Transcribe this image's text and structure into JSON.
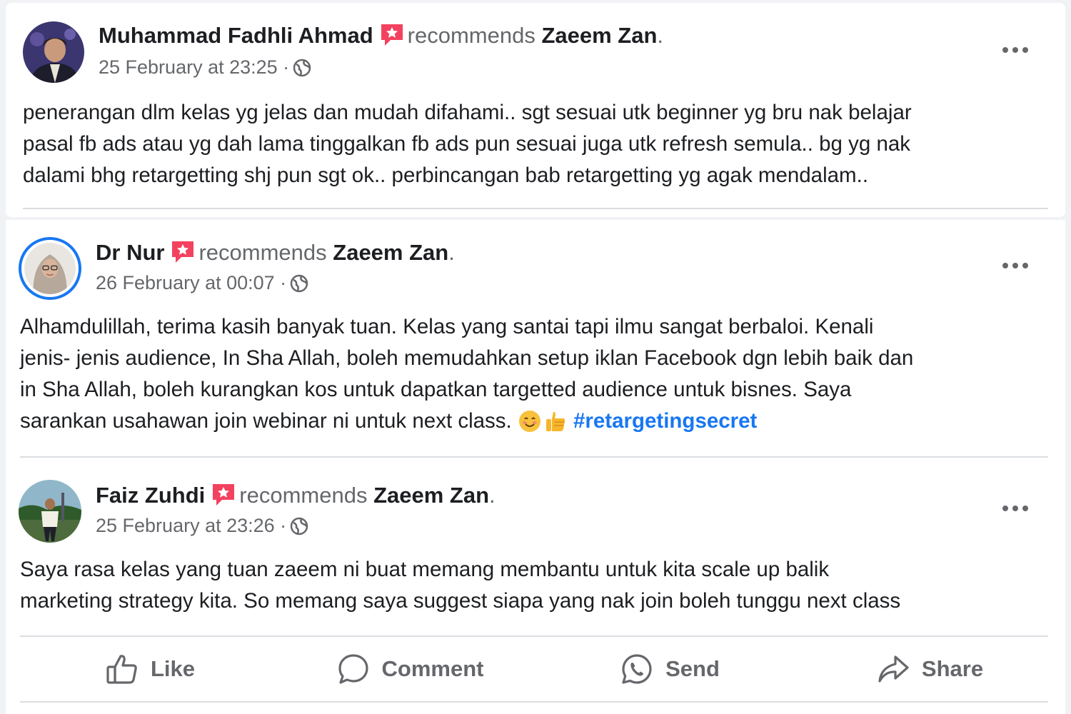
{
  "posts": [
    {
      "author": "Muhammad Fadhli Ahmad",
      "recommends_text": "recommends",
      "page": "Zaeem Zan",
      "timestamp": "25 February at 23:25 ·",
      "privacy_icon": "globe-icon",
      "lines": [
        "penerangan dlm kelas yg jelas dan mudah difahami.. sgt sesuai utk beginner yg bru nak belajar",
        "pasal fb ads atau yg dah lama tinggalkan fb ads pun sesuai juga utk refresh semula.. bg yg nak",
        "dalami bhg retargetting shj pun sgt ok.. perbincangan bab retargetting yg agak mendalam.."
      ]
    },
    {
      "author": "Dr Nur",
      "recommends_text": "recommends",
      "page": "Zaeem Zan",
      "timestamp": "26 February at 00:07 ·",
      "privacy_icon": "globe-icon",
      "lines": [
        "Alhamdulillah, terima kasih banyak tuan. Kelas yang santai tapi ilmu sangat berbaloi. Kenali",
        "jenis- jenis audience, In Sha Allah, boleh memudahkan setup iklan Facebook dgn lebih baik dan",
        "in Sha Allah, boleh kurangkan kos untuk dapatkan targetted audience untuk bisnes. Saya",
        "sarankan usahawan join webinar ni untuk next class."
      ],
      "hashtag": "#retargetingsecret"
    },
    {
      "author": "Faiz Zuhdi",
      "recommends_text": "recommends",
      "page": "Zaeem Zan",
      "timestamp": "25 February at 23:26 ·",
      "privacy_icon": "globe-icon",
      "lines": [
        "Saya rasa kelas yang tuan zaeem ni buat memang membantu untuk kita scale up balik",
        "marketing strategy kita. So memang saya suggest siapa yang nak join boleh tunggu next class"
      ]
    }
  ],
  "period": ".",
  "actions": {
    "like": "Like",
    "comment": "Comment",
    "send": "Send",
    "share": "Share"
  },
  "colors": {
    "background": "#f0f2f5",
    "card": "#ffffff",
    "text_primary": "#1c1e21",
    "text_secondary": "#65676b",
    "link": "#1877f2",
    "recommend_badge": "#f3425f",
    "divider": "#dadde1"
  }
}
